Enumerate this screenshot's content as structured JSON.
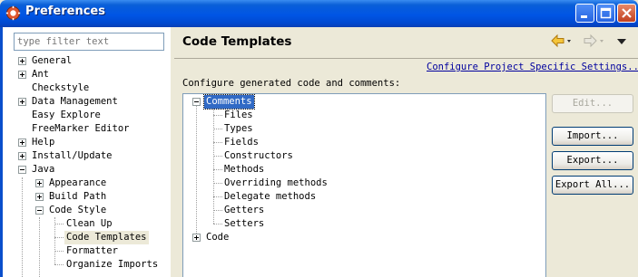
{
  "window": {
    "title": "Preferences",
    "buttons": {
      "minimize": "minimize",
      "maximize": "maximize",
      "close": "close"
    }
  },
  "filter": {
    "placeholder": "type filter text"
  },
  "nav_tree": [
    {
      "label": "General",
      "expander": "plus",
      "level": 0
    },
    {
      "label": "Ant",
      "expander": "plus",
      "level": 0
    },
    {
      "label": "Checkstyle",
      "expander": "none",
      "level": 0
    },
    {
      "label": "Data Management",
      "expander": "plus",
      "level": 0
    },
    {
      "label": "Easy Explore",
      "expander": "none",
      "level": 0
    },
    {
      "label": "FreeMarker Editor",
      "expander": "none",
      "level": 0
    },
    {
      "label": "Help",
      "expander": "plus",
      "level": 0
    },
    {
      "label": "Install/Update",
      "expander": "plus",
      "level": 0
    },
    {
      "label": "Java",
      "expander": "minus",
      "level": 0
    },
    {
      "label": "Appearance",
      "expander": "plus",
      "level": 1
    },
    {
      "label": "Build Path",
      "expander": "plus",
      "level": 1
    },
    {
      "label": "Code Style",
      "expander": "minus",
      "level": 1
    },
    {
      "label": "Clean Up",
      "expander": "none",
      "level": 2
    },
    {
      "label": "Code Templates",
      "expander": "none",
      "level": 2,
      "selected": true
    },
    {
      "label": "Formatter",
      "expander": "none",
      "level": 2
    },
    {
      "label": "Organize Imports",
      "expander": "none",
      "level": 2
    }
  ],
  "page": {
    "title": "Code Templates",
    "config_link": "Configure Project Specific Settings...",
    "description": "Configure generated code and comments:"
  },
  "template_tree": {
    "comments": "Comments",
    "children": [
      "Files",
      "Types",
      "Fields",
      "Constructors",
      "Methods",
      "Overriding methods",
      "Delegate methods",
      "Getters",
      "Setters"
    ],
    "code": "Code"
  },
  "buttons": {
    "edit": "Edit...",
    "import": "Import...",
    "export": "Export...",
    "export_all": "Export All..."
  },
  "colors": {
    "title_bar": "#0055E5",
    "selection": "#316AC5",
    "link": "#00009E",
    "dialog_bg": "#ECE9D8"
  }
}
